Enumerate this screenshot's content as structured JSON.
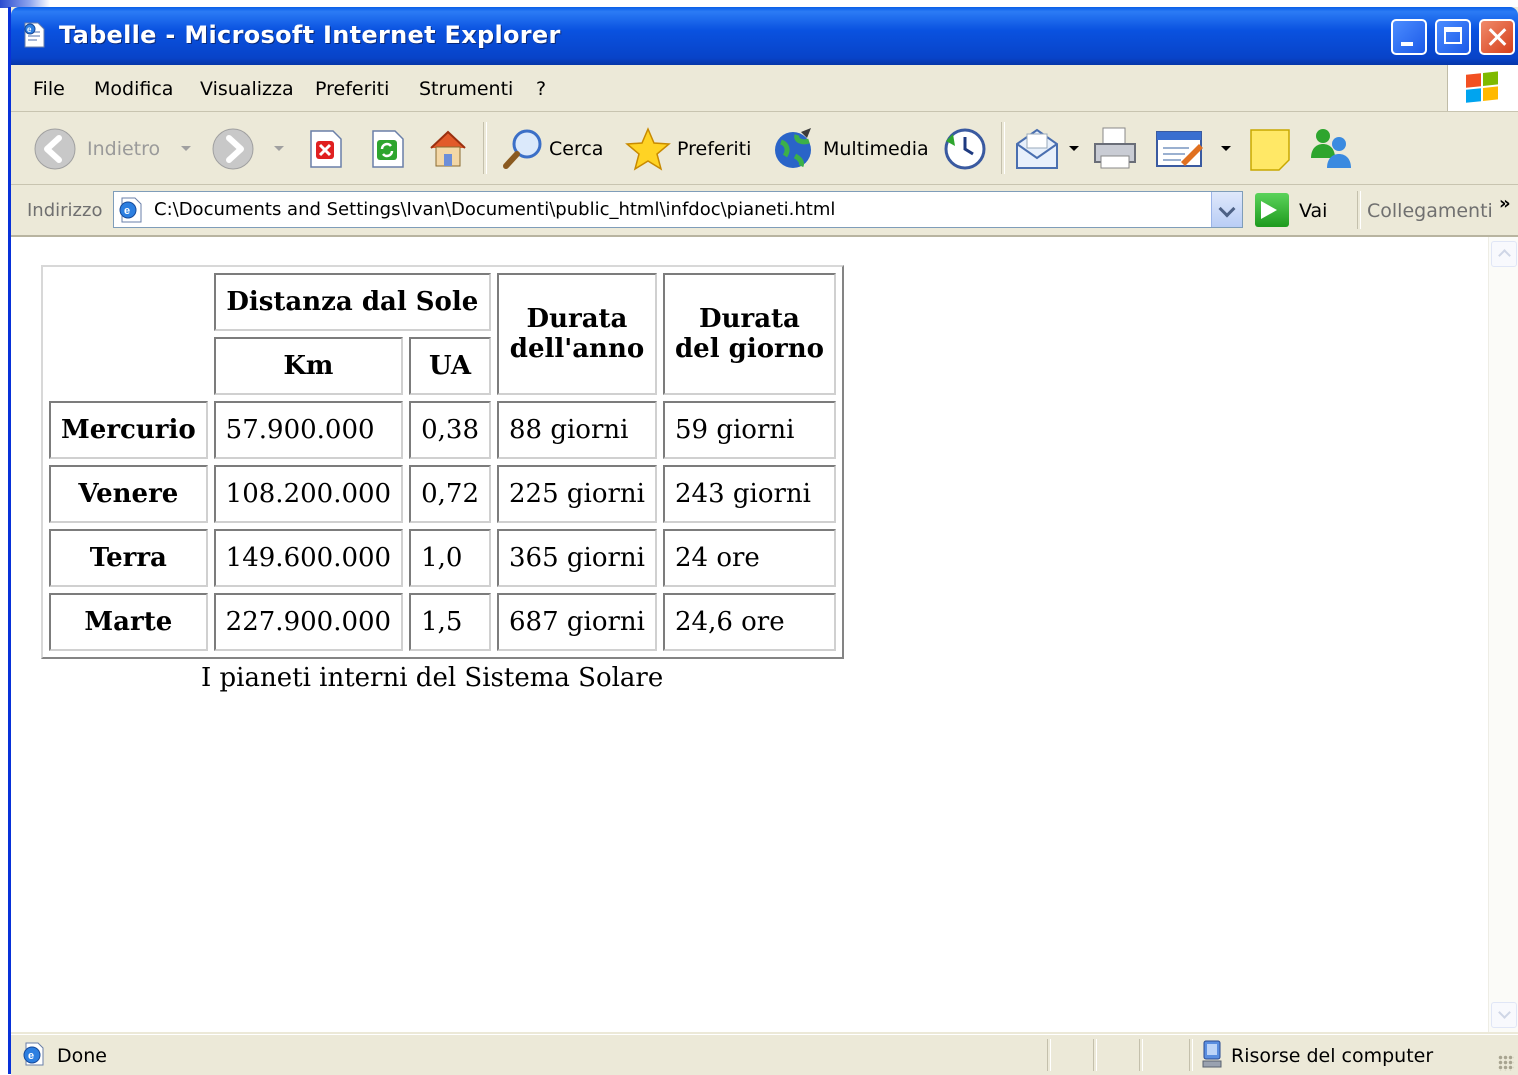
{
  "window": {
    "title": "Tabelle - Microsoft Internet Explorer"
  },
  "menu": [
    "File",
    "Modifica",
    "Visualizza",
    "Preferiti",
    "Strumenti",
    "?"
  ],
  "toolbar": {
    "back": "Indietro",
    "search": "Cerca",
    "favorites": "Preferiti",
    "media": "Multimedia"
  },
  "address": {
    "label": "Indirizzo",
    "value": "C:\\Documents and Settings\\Ivan\\Documenti\\public_html\\infdoc\\pianeti.html",
    "go": "Vai",
    "links": "Collegamenti",
    "more": "»"
  },
  "table": {
    "header_group": "Distanza dal Sole",
    "col_km": "Km",
    "col_ua": "UA",
    "col_year_1": "Durata",
    "col_year_2": "dell'anno",
    "col_day_1": "Durata",
    "col_day_2": "del giorno",
    "rows": [
      {
        "name": "Mercurio",
        "km": "57.900.000",
        "ua": "0,38",
        "year": "88 giorni",
        "day": "59 giorni"
      },
      {
        "name": "Venere",
        "km": "108.200.000",
        "ua": "0,72",
        "year": "225 giorni",
        "day": "243 giorni"
      },
      {
        "name": "Terra",
        "km": "149.600.000",
        "ua": "1,0",
        "year": "365 giorni",
        "day": "24 ore"
      },
      {
        "name": "Marte",
        "km": "227.900.000",
        "ua": "1,5",
        "year": "687 giorni",
        "day": "24,6 ore"
      }
    ],
    "caption": "I pianeti interni del Sistema Solare"
  },
  "status": {
    "text": "Done",
    "zone": "Risorse del computer"
  },
  "colors": {
    "title_blue": "#0a52e0",
    "chrome": "#ece9d8",
    "frame_blue": "#0831d9"
  }
}
